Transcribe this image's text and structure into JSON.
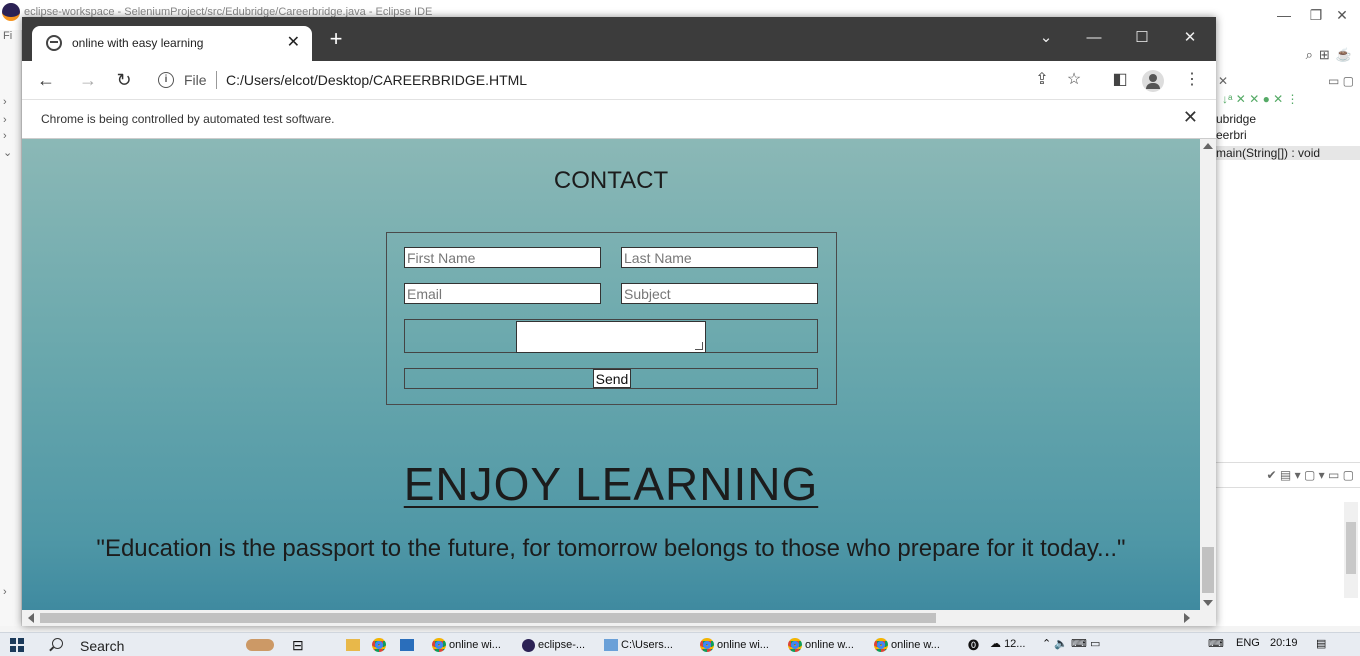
{
  "eclipse": {
    "title": "eclipse-workspace - SeleniumProject/src/Edubridge/Careerbridge.java - Eclipse IDE",
    "menu_hint": "Fi",
    "outline_rows": [
      "ubridge",
      "eerbri",
      "main(String[]) : void"
    ]
  },
  "browser": {
    "tab_title": "online with easy learning",
    "new_tab": "+",
    "url_scheme": "File",
    "url": "C:/Users/elcot/Desktop/CAREERBRIDGE.HTML",
    "infobar_message": "Chrome is being controlled by automated test software."
  },
  "page": {
    "contact_heading": "CONTACT",
    "first_name_placeholder": "First Name",
    "last_name_placeholder": "Last Name",
    "email_placeholder": "Email",
    "subject_placeholder": "Subject",
    "send_label": "Send",
    "enjoy_heading": "ENJOY LEARNING",
    "quote": "\"Education is the passport to the future, for tomorrow belongs to those who prepare for it today...\""
  },
  "taskbar": {
    "search_label": "Search",
    "apps": [
      {
        "label": "online wi...",
        "icon": "chrome-icon"
      },
      {
        "label": "eclipse-...",
        "icon": "eclipse-icon"
      },
      {
        "label": "C:\\Users...",
        "icon": "notepad-icon"
      },
      {
        "label": "online wi...",
        "icon": "chrome-icon"
      },
      {
        "label": "online w...",
        "icon": "chrome-icon"
      },
      {
        "label": "online w...",
        "icon": "chrome-icon"
      }
    ],
    "weather": "12...",
    "language": "ENG",
    "time": "20:19"
  },
  "colors": {
    "page_gradient_top": "#8bb8b6",
    "page_gradient_bottom": "#3f8aa0",
    "tabstrip": "#3c3c3c"
  }
}
